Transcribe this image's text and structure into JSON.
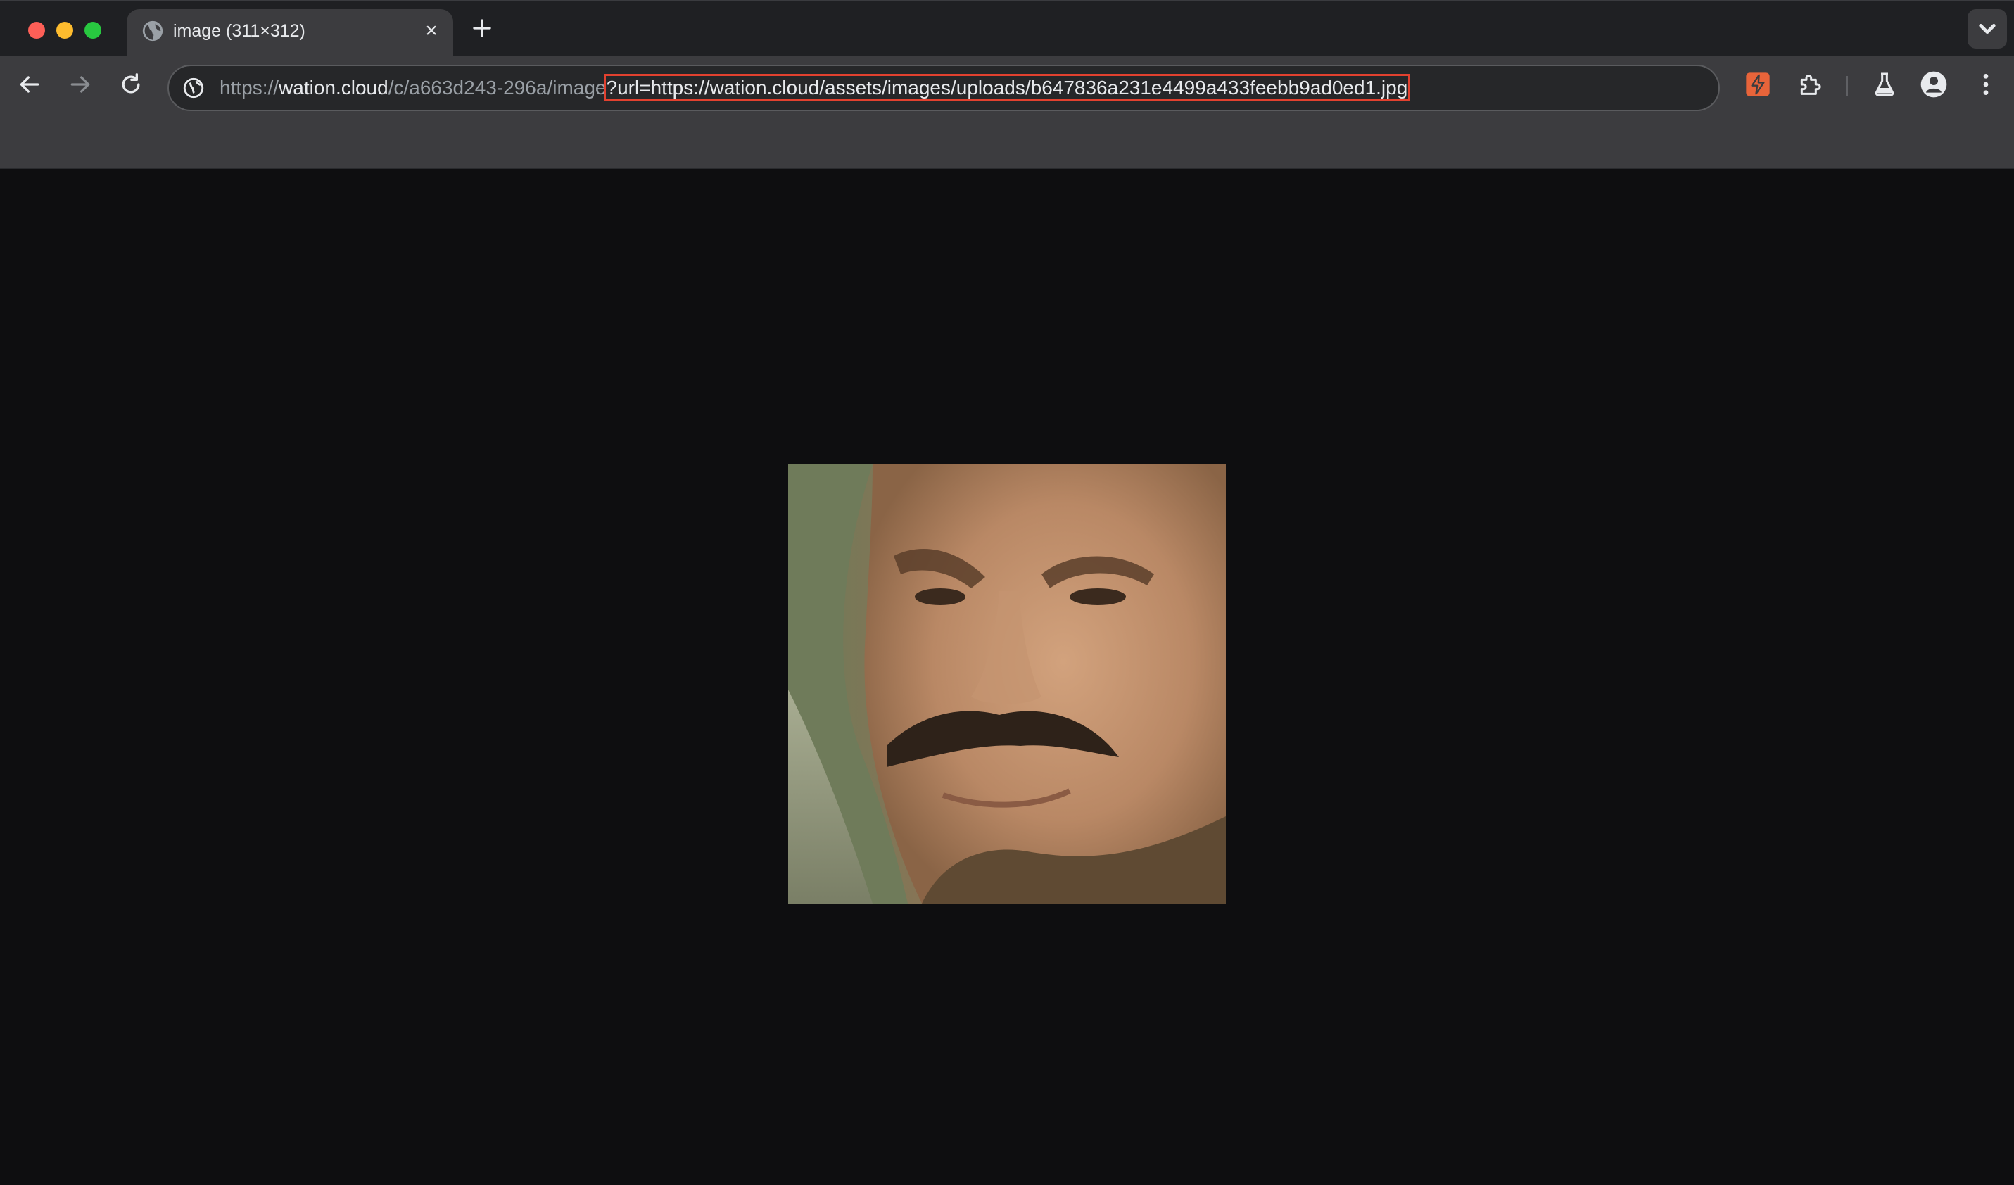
{
  "browser": {
    "tab": {
      "title": "image (311×312)",
      "favicon": "globe-icon",
      "close": "×"
    },
    "new_tab_icon": "plus-icon",
    "tab_search_icon": "chevron-down-icon"
  },
  "toolbar": {
    "back_icon": "arrow-left-icon",
    "forward_icon": "arrow-right-icon",
    "reload_icon": "reload-icon",
    "site_info_icon": "site-info-icon",
    "url": {
      "scheme": "https://",
      "host": "wation.cloud",
      "path": "/c/a663d243-296a/image",
      "query": "?url=https://watio​n.cloud/assets/images/uploads/b647836a231e4499a433feebb9ad0ed1.jpg"
    },
    "extensions": [
      "zap-extension-icon",
      "puzzle-icon",
      "labs-flask-icon",
      "profile-icon",
      "kebab-menu-icon"
    ],
    "zap_color": "#e8643a",
    "highlight_color": "#e2412f"
  },
  "content": {
    "image_alt": "photo of a man with a mustache",
    "background_color": "#0e0e10"
  }
}
